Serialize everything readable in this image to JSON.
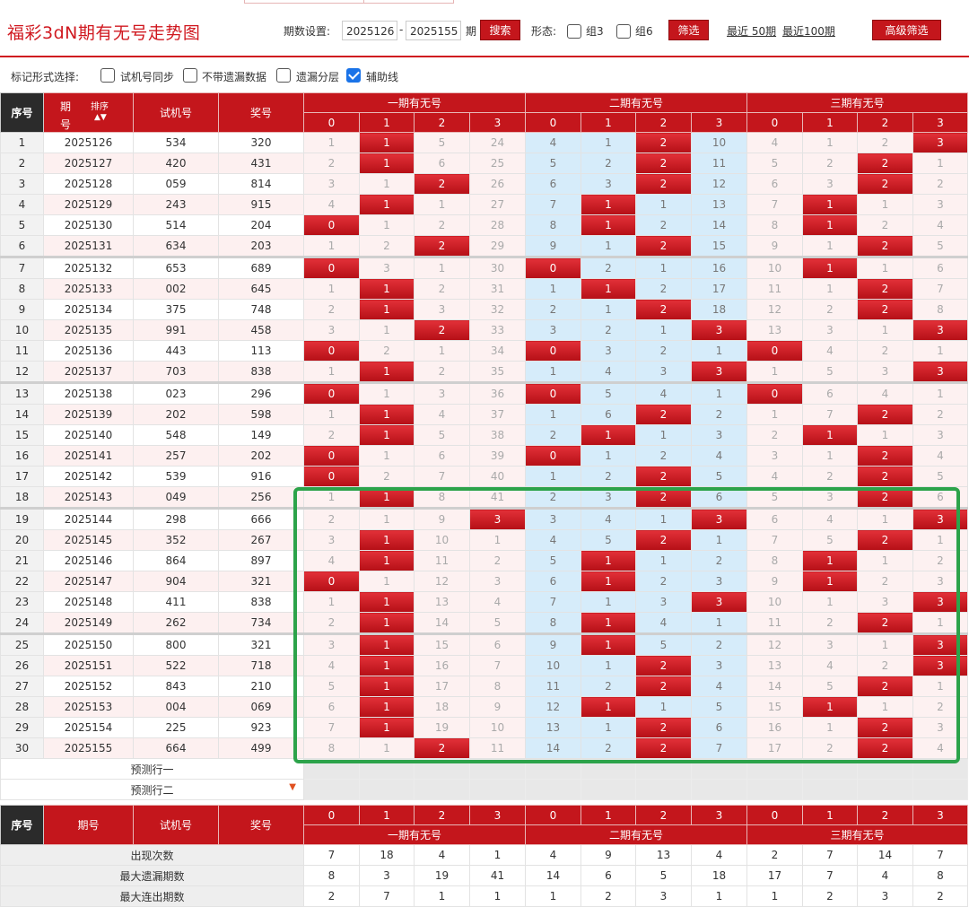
{
  "topbar": {
    "title": "福彩3dN期有无号走势图",
    "period_label": "期数设置:",
    "period_from": "2025126",
    "period_to": "2025155",
    "period_unit": "期",
    "search_label": "搜索",
    "form_label": "形态:",
    "group3_label": "组3",
    "group6_label": "组6",
    "filter_label": "筛选",
    "recent50_label": "最近 50期",
    "recent100_label": "最近100期",
    "advanced_label": "高级筛选"
  },
  "markrow": {
    "label": "标记形式选择:",
    "opt1": "试机号同步",
    "opt2": "不带遗漏数据",
    "opt3": "遗漏分层",
    "opt4": "辅助线",
    "opt4_checked": true
  },
  "table": {
    "h_seq": "序号",
    "h_period_a": "期",
    "h_period_b": "号",
    "h_sort": "排序",
    "h_sort_icon": "sort-arrows-icon",
    "h_trial": "试机号",
    "h_draw": "奖号",
    "groups": [
      "一期有无号",
      "二期有无号",
      "三期有无号"
    ],
    "sub": [
      "0",
      "1",
      "2",
      "3"
    ],
    "rows": [
      {
        "idx": "1",
        "period": "2025126",
        "trial": "534",
        "draw": "320",
        "vals": [
          "1",
          "1",
          "5",
          "24",
          "4",
          "1",
          "2",
          "10",
          "4",
          "1",
          "2",
          "3"
        ],
        "hits": [
          1,
          6,
          11
        ]
      },
      {
        "idx": "2",
        "period": "2025127",
        "trial": "420",
        "draw": "431",
        "vals": [
          "2",
          "1",
          "6",
          "25",
          "5",
          "2",
          "2",
          "11",
          "5",
          "2",
          "2",
          "1"
        ],
        "hits": [
          1,
          6,
          10
        ]
      },
      {
        "idx": "3",
        "period": "2025128",
        "trial": "059",
        "draw": "814",
        "vals": [
          "3",
          "1",
          "2",
          "26",
          "6",
          "3",
          "2",
          "12",
          "6",
          "3",
          "2",
          "2"
        ],
        "hits": [
          2,
          6,
          10
        ]
      },
      {
        "idx": "4",
        "period": "2025129",
        "trial": "243",
        "draw": "915",
        "vals": [
          "4",
          "1",
          "1",
          "27",
          "7",
          "1",
          "1",
          "13",
          "7",
          "1",
          "1",
          "3"
        ],
        "hits": [
          1,
          5,
          9
        ]
      },
      {
        "idx": "5",
        "period": "2025130",
        "trial": "514",
        "draw": "204",
        "vals": [
          "0",
          "1",
          "2",
          "28",
          "8",
          "1",
          "2",
          "14",
          "8",
          "1",
          "2",
          "4"
        ],
        "hits": [
          0,
          5,
          9
        ]
      },
      {
        "idx": "6",
        "period": "2025131",
        "trial": "634",
        "draw": "203",
        "vals": [
          "1",
          "2",
          "2",
          "29",
          "9",
          "1",
          "2",
          "15",
          "9",
          "1",
          "2",
          "5"
        ],
        "hits": [
          2,
          6,
          10
        ]
      },
      {
        "idx": "7",
        "period": "2025132",
        "trial": "653",
        "draw": "689",
        "vals": [
          "0",
          "3",
          "1",
          "30",
          "0",
          "2",
          "1",
          "16",
          "10",
          "1",
          "1",
          "6"
        ],
        "hits": [
          0,
          4,
          9
        ]
      },
      {
        "idx": "8",
        "period": "2025133",
        "trial": "002",
        "draw": "645",
        "vals": [
          "1",
          "1",
          "2",
          "31",
          "1",
          "1",
          "2",
          "17",
          "11",
          "1",
          "2",
          "7"
        ],
        "hits": [
          1,
          5,
          10
        ]
      },
      {
        "idx": "9",
        "period": "2025134",
        "trial": "375",
        "draw": "748",
        "vals": [
          "2",
          "1",
          "3",
          "32",
          "2",
          "1",
          "2",
          "18",
          "12",
          "2",
          "2",
          "8"
        ],
        "hits": [
          1,
          6,
          10
        ]
      },
      {
        "idx": "10",
        "period": "2025135",
        "trial": "991",
        "draw": "458",
        "vals": [
          "3",
          "1",
          "2",
          "33",
          "3",
          "2",
          "1",
          "3",
          "13",
          "3",
          "1",
          "3"
        ],
        "hits": [
          2,
          7,
          11
        ]
      },
      {
        "idx": "11",
        "period": "2025136",
        "trial": "443",
        "draw": "113",
        "vals": [
          "0",
          "2",
          "1",
          "34",
          "0",
          "3",
          "2",
          "1",
          "0",
          "4",
          "2",
          "1"
        ],
        "hits": [
          0,
          4,
          8
        ]
      },
      {
        "idx": "12",
        "period": "2025137",
        "trial": "703",
        "draw": "838",
        "vals": [
          "1",
          "1",
          "2",
          "35",
          "1",
          "4",
          "3",
          "3",
          "1",
          "5",
          "3",
          "3"
        ],
        "hits": [
          1,
          7,
          11
        ]
      },
      {
        "idx": "13",
        "period": "2025138",
        "trial": "023",
        "draw": "296",
        "vals": [
          "0",
          "1",
          "3",
          "36",
          "0",
          "5",
          "4",
          "1",
          "0",
          "6",
          "4",
          "1"
        ],
        "hits": [
          0,
          4,
          8
        ]
      },
      {
        "idx": "14",
        "period": "2025139",
        "trial": "202",
        "draw": "598",
        "vals": [
          "1",
          "1",
          "4",
          "37",
          "1",
          "6",
          "2",
          "2",
          "1",
          "7",
          "2",
          "2"
        ],
        "hits": [
          1,
          6,
          10
        ]
      },
      {
        "idx": "15",
        "period": "2025140",
        "trial": "548",
        "draw": "149",
        "vals": [
          "2",
          "1",
          "5",
          "38",
          "2",
          "1",
          "1",
          "3",
          "2",
          "1",
          "1",
          "3"
        ],
        "hits": [
          1,
          5,
          9
        ]
      },
      {
        "idx": "16",
        "period": "2025141",
        "trial": "257",
        "draw": "202",
        "vals": [
          "0",
          "1",
          "6",
          "39",
          "0",
          "1",
          "2",
          "4",
          "3",
          "1",
          "2",
          "4"
        ],
        "hits": [
          0,
          4,
          10
        ]
      },
      {
        "idx": "17",
        "period": "2025142",
        "trial": "539",
        "draw": "916",
        "vals": [
          "0",
          "2",
          "7",
          "40",
          "1",
          "2",
          "2",
          "5",
          "4",
          "2",
          "2",
          "5"
        ],
        "hits": [
          0,
          6,
          10
        ]
      },
      {
        "idx": "18",
        "period": "2025143",
        "trial": "049",
        "draw": "256",
        "vals": [
          "1",
          "1",
          "8",
          "41",
          "2",
          "3",
          "2",
          "6",
          "5",
          "3",
          "2",
          "6"
        ],
        "hits": [
          1,
          6,
          10
        ]
      },
      {
        "idx": "19",
        "period": "2025144",
        "trial": "298",
        "draw": "666",
        "vals": [
          "2",
          "1",
          "9",
          "3",
          "3",
          "4",
          "1",
          "3",
          "6",
          "4",
          "1",
          "3"
        ],
        "hits": [
          3,
          7,
          11
        ]
      },
      {
        "idx": "20",
        "period": "2025145",
        "trial": "352",
        "draw": "267",
        "vals": [
          "3",
          "1",
          "10",
          "1",
          "4",
          "5",
          "2",
          "1",
          "7",
          "5",
          "2",
          "1"
        ],
        "hits": [
          1,
          6,
          10
        ]
      },
      {
        "idx": "21",
        "period": "2025146",
        "trial": "864",
        "draw": "897",
        "vals": [
          "4",
          "1",
          "11",
          "2",
          "5",
          "1",
          "1",
          "2",
          "8",
          "1",
          "1",
          "2"
        ],
        "hits": [
          1,
          5,
          9
        ]
      },
      {
        "idx": "22",
        "period": "2025147",
        "trial": "904",
        "draw": "321",
        "vals": [
          "0",
          "1",
          "12",
          "3",
          "6",
          "1",
          "2",
          "3",
          "9",
          "1",
          "2",
          "3"
        ],
        "hits": [
          0,
          5,
          9
        ]
      },
      {
        "idx": "23",
        "period": "2025148",
        "trial": "411",
        "draw": "838",
        "vals": [
          "1",
          "1",
          "13",
          "4",
          "7",
          "1",
          "3",
          "3",
          "10",
          "1",
          "3",
          "3"
        ],
        "hits": [
          1,
          7,
          11
        ]
      },
      {
        "idx": "24",
        "period": "2025149",
        "trial": "262",
        "draw": "734",
        "vals": [
          "2",
          "1",
          "14",
          "5",
          "8",
          "1",
          "4",
          "1",
          "11",
          "2",
          "2",
          "1"
        ],
        "hits": [
          1,
          5,
          10
        ]
      },
      {
        "idx": "25",
        "period": "2025150",
        "trial": "800",
        "draw": "321",
        "vals": [
          "3",
          "1",
          "15",
          "6",
          "9",
          "1",
          "5",
          "2",
          "12",
          "3",
          "1",
          "3"
        ],
        "hits": [
          1,
          5,
          11
        ]
      },
      {
        "idx": "26",
        "period": "2025151",
        "trial": "522",
        "draw": "718",
        "vals": [
          "4",
          "1",
          "16",
          "7",
          "10",
          "1",
          "2",
          "3",
          "13",
          "4",
          "2",
          "3"
        ],
        "hits": [
          1,
          6,
          11
        ]
      },
      {
        "idx": "27",
        "period": "2025152",
        "trial": "843",
        "draw": "210",
        "vals": [
          "5",
          "1",
          "17",
          "8",
          "11",
          "2",
          "2",
          "4",
          "14",
          "5",
          "2",
          "1"
        ],
        "hits": [
          1,
          6,
          10
        ]
      },
      {
        "idx": "28",
        "period": "2025153",
        "trial": "004",
        "draw": "069",
        "vals": [
          "6",
          "1",
          "18",
          "9",
          "12",
          "1",
          "1",
          "5",
          "15",
          "1",
          "1",
          "2"
        ],
        "hits": [
          1,
          5,
          9
        ]
      },
      {
        "idx": "29",
        "period": "2025154",
        "trial": "225",
        "draw": "923",
        "vals": [
          "7",
          "1",
          "19",
          "10",
          "13",
          "1",
          "2",
          "6",
          "16",
          "1",
          "2",
          "3"
        ],
        "hits": [
          1,
          6,
          10
        ]
      },
      {
        "idx": "30",
        "period": "2025155",
        "trial": "664",
        "draw": "499",
        "vals": [
          "8",
          "1",
          "2",
          "11",
          "14",
          "2",
          "2",
          "7",
          "17",
          "2",
          "2",
          "4"
        ],
        "hits": [
          2,
          6,
          10
        ]
      }
    ],
    "pred1": "预测行一",
    "pred2": "预测行二",
    "pred2_icon": "arrow-down-icon",
    "stats": [
      {
        "label": "出现次数",
        "vals": [
          "7",
          "18",
          "4",
          "1",
          "4",
          "9",
          "13",
          "4",
          "2",
          "7",
          "14",
          "7"
        ]
      },
      {
        "label": "最大遗漏期数",
        "vals": [
          "8",
          "3",
          "19",
          "41",
          "14",
          "6",
          "5",
          "18",
          "17",
          "7",
          "4",
          "8"
        ]
      },
      {
        "label": "最大连出期数",
        "vals": [
          "2",
          "7",
          "1",
          "1",
          "1",
          "2",
          "3",
          "1",
          "1",
          "2",
          "3",
          "2"
        ]
      }
    ]
  },
  "colors": {
    "accent_red": "#c4161c",
    "title_red": "#d01920",
    "light_blue": "#d6ecfa",
    "highlight_green": "#2ca34a"
  }
}
